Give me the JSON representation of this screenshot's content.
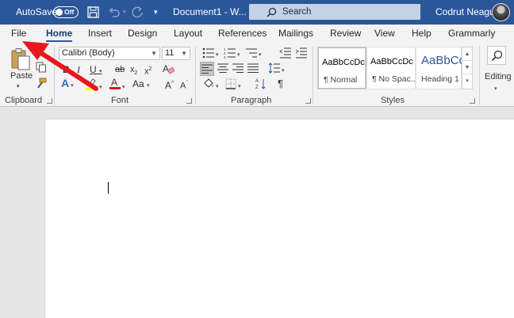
{
  "titlebar": {
    "autosave_label": "AutoSave",
    "autosave_state": "Off",
    "document_title": "Document1 - W...",
    "search_label": "Search",
    "user_name": "Codrut Neagu"
  },
  "tabs": [
    {
      "label": "File"
    },
    {
      "label": "Home"
    },
    {
      "label": "Insert"
    },
    {
      "label": "Design"
    },
    {
      "label": "Layout"
    },
    {
      "label": "References"
    },
    {
      "label": "Mailings"
    },
    {
      "label": "Review"
    },
    {
      "label": "View"
    },
    {
      "label": "Help"
    },
    {
      "label": "Grammarly"
    }
  ],
  "active_tab": "Home",
  "ribbon": {
    "clipboard": {
      "label": "Clipboard",
      "paste_label": "Paste"
    },
    "font": {
      "label": "Font",
      "font_name": "Calibri (Body)",
      "font_size": "11"
    },
    "paragraph": {
      "label": "Paragraph"
    },
    "styles": {
      "label": "Styles",
      "items": [
        {
          "sample": "AaBbCcDc",
          "name": "¶ Normal"
        },
        {
          "sample": "AaBbCcDc",
          "name": "¶ No Spac..."
        },
        {
          "sample": "AaBbCc",
          "name": "Heading 1"
        }
      ]
    },
    "editing": {
      "label": "Editing"
    }
  },
  "colors": {
    "titlebar": "#2b579a",
    "ribbon_bg": "#f3f3f3",
    "arrow": "#e8161c",
    "highlight_yellow": "#ffff00",
    "font_color_red": "#e81123"
  }
}
